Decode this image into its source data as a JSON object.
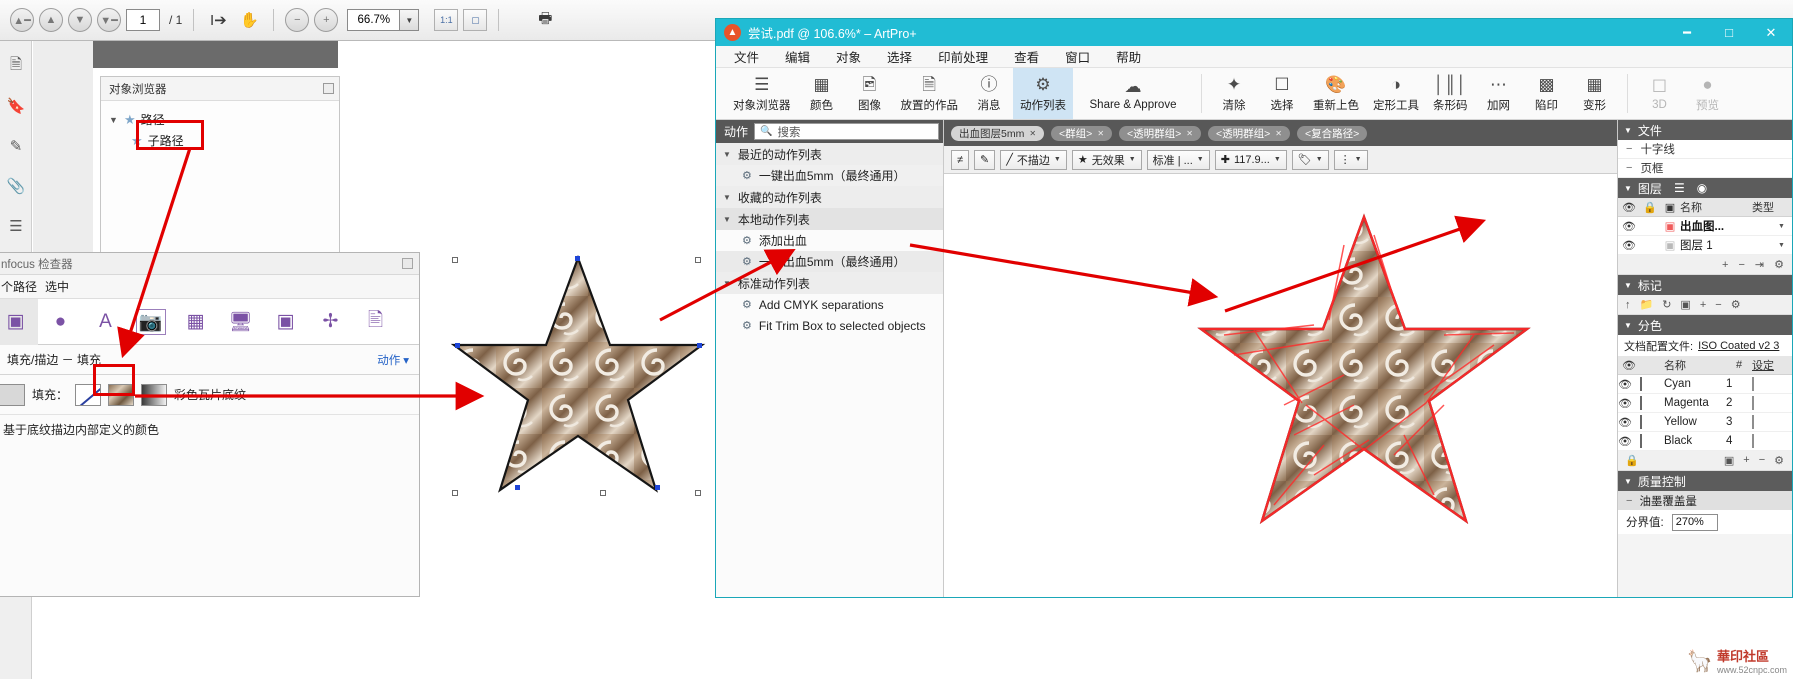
{
  "pdf_viewer": {
    "toolbar": {
      "page_current": "1",
      "page_total": "/ 1",
      "zoom_value": "66.7%",
      "icons": [
        "first-page-icon",
        "previous-page-icon",
        "next-page-icon",
        "last-page-icon",
        "text-select-icon",
        "hand-tool-icon",
        "zoom-out-icon",
        "zoom-in-icon",
        "actual-size-icon",
        "fit-page-icon",
        "print-icon"
      ]
    },
    "object_browser": {
      "title": "对象浏览器",
      "tree": [
        {
          "label": "路径",
          "level": 0
        },
        {
          "label": "子路径",
          "level": 1
        }
      ]
    }
  },
  "infocus": {
    "title": "nfocus 检查器",
    "subtitle_left": "个路径",
    "subtitle_right": "选中",
    "icons": [
      "object-icon",
      "shape-icon",
      "text-icon",
      "image-icon",
      "transparency-icon",
      "screen-icon",
      "color-icon",
      "position-icon",
      "document-icon"
    ],
    "section_title": "填充/描边 － 填充",
    "section_action": "动作",
    "fill_label": "填充：",
    "fill_name": "彩色瓦片底纹",
    "note": "基于底纹描边内部定义的颜色"
  },
  "artpro": {
    "title": "尝试.pdf @ 106.6%* – ArtPro+",
    "window_buttons": [
      "minimize",
      "maximize",
      "close"
    ],
    "menu": [
      "文件",
      "编辑",
      "对象",
      "选择",
      "印前处理",
      "查看",
      "窗口",
      "帮助"
    ],
    "ribbon": [
      {
        "label": "对象浏览器",
        "icon": "object-browser-icon",
        "selected": false,
        "dim": false
      },
      {
        "label": "颜色",
        "icon": "color-swatches-icon",
        "selected": false,
        "dim": false
      },
      {
        "label": "图像",
        "icon": "image-icon",
        "selected": false,
        "dim": false
      },
      {
        "label": "放置的作品",
        "icon": "placed-art-icon",
        "selected": false,
        "dim": false
      },
      {
        "label": "消息",
        "icon": "info-icon",
        "selected": false,
        "dim": false
      },
      {
        "label": "动作列表",
        "icon": "gears-icon",
        "selected": true,
        "dim": false
      },
      {
        "label": "Share & Approve",
        "icon": "cloud-check-icon",
        "selected": false,
        "dim": false
      },
      {
        "label": "清除",
        "icon": "sparkle-icon",
        "selected": false,
        "dim": false
      },
      {
        "label": "选择",
        "icon": "select-box-icon",
        "selected": false,
        "dim": false
      },
      {
        "label": "重新上色",
        "icon": "recolor-icon",
        "selected": false,
        "dim": false
      },
      {
        "label": "定形工具",
        "icon": "shape-tool-icon",
        "selected": false,
        "dim": false
      },
      {
        "label": "条形码",
        "icon": "barcode-icon",
        "selected": false,
        "dim": false
      },
      {
        "label": "加网",
        "icon": "screening-icon",
        "selected": false,
        "dim": false
      },
      {
        "label": "陷印",
        "icon": "trapping-icon",
        "selected": false,
        "dim": false
      },
      {
        "label": "变形",
        "icon": "warp-icon",
        "selected": false,
        "dim": false
      },
      {
        "label": "3D",
        "icon": "cube-icon",
        "selected": false,
        "dim": true
      },
      {
        "label": "预览",
        "icon": "preview-icon",
        "selected": false,
        "dim": true
      }
    ],
    "actions_panel": {
      "header_label": "动作",
      "search_placeholder": "搜索",
      "groups": [
        {
          "label": "最近的动作列表",
          "items": [
            {
              "label": "一键出血5mm（最终通用）"
            }
          ]
        },
        {
          "label": "收藏的动作列表",
          "items": []
        },
        {
          "label": "本地动作列表",
          "items": [
            {
              "label": "添加出血"
            },
            {
              "label": "一键出血5mm（最终通用）"
            }
          ]
        },
        {
          "label": "标准动作列表",
          "items": [
            {
              "label": "Add CMYK separations"
            },
            {
              "label": "Fit Trim Box to selected objects"
            }
          ]
        }
      ]
    },
    "option_bar": {
      "pills": [
        {
          "label": "出血图层5mm",
          "close": true,
          "style": "light"
        },
        {
          "label": "<群组>",
          "close": true,
          "style": "dark"
        },
        {
          "label": "<透明群组>",
          "close": true,
          "style": "dark"
        },
        {
          "label": "<透明群组>",
          "close": true,
          "style": "dark"
        },
        {
          "label": "<复合路径>",
          "close": false,
          "style": "dark"
        }
      ]
    },
    "prop_bar": {
      "stroke_label": "不描边",
      "effect_label": "无效果",
      "standard_label": "标准 | ...",
      "position_value": "117.9...",
      "icons": [
        "align-icon",
        "edit-icon",
        "stroke-icon",
        "effect-icon",
        "standard-icon",
        "move-icon",
        "tag-icon",
        "screen-dots-icon"
      ]
    },
    "right_panel": {
      "file_panel": {
        "title": "文件",
        "rows": [
          "十字线",
          "页框"
        ]
      },
      "layers_panel": {
        "title": "图层",
        "columns": [
          "名称",
          "类型"
        ],
        "rows": [
          {
            "name": "出血图...",
            "type": ""
          },
          {
            "name": "图层 1",
            "type": ""
          }
        ],
        "buttons": [
          "add",
          "remove",
          "indent",
          "settings"
        ]
      },
      "marks_panel": {
        "title": "标记",
        "buttons": [
          "import",
          "folder",
          "refresh",
          "add-mark",
          "plus",
          "minus",
          "settings"
        ]
      },
      "separations_panel": {
        "title": "分色",
        "profile_label": "文档配置文件:",
        "profile_value": "ISO Coated v2 3",
        "columns": [
          "名称",
          "#",
          "设定"
        ],
        "rows": [
          {
            "name": "Cyan",
            "number": "1",
            "color": "#00a0d8"
          },
          {
            "name": "Magenta",
            "number": "2",
            "color": "#e8008c"
          },
          {
            "name": "Yellow",
            "number": "3",
            "color": "#ffdd00"
          },
          {
            "name": "Black",
            "number": "4",
            "color": "#111111"
          }
        ]
      },
      "quality_panel": {
        "title": "质量控制",
        "row_label": "油墨覆盖量",
        "field_label": "分界值:",
        "field_value": "270%"
      }
    }
  },
  "watermark": {
    "title": "華印社區",
    "subtitle": "www.52cnpc.com"
  }
}
